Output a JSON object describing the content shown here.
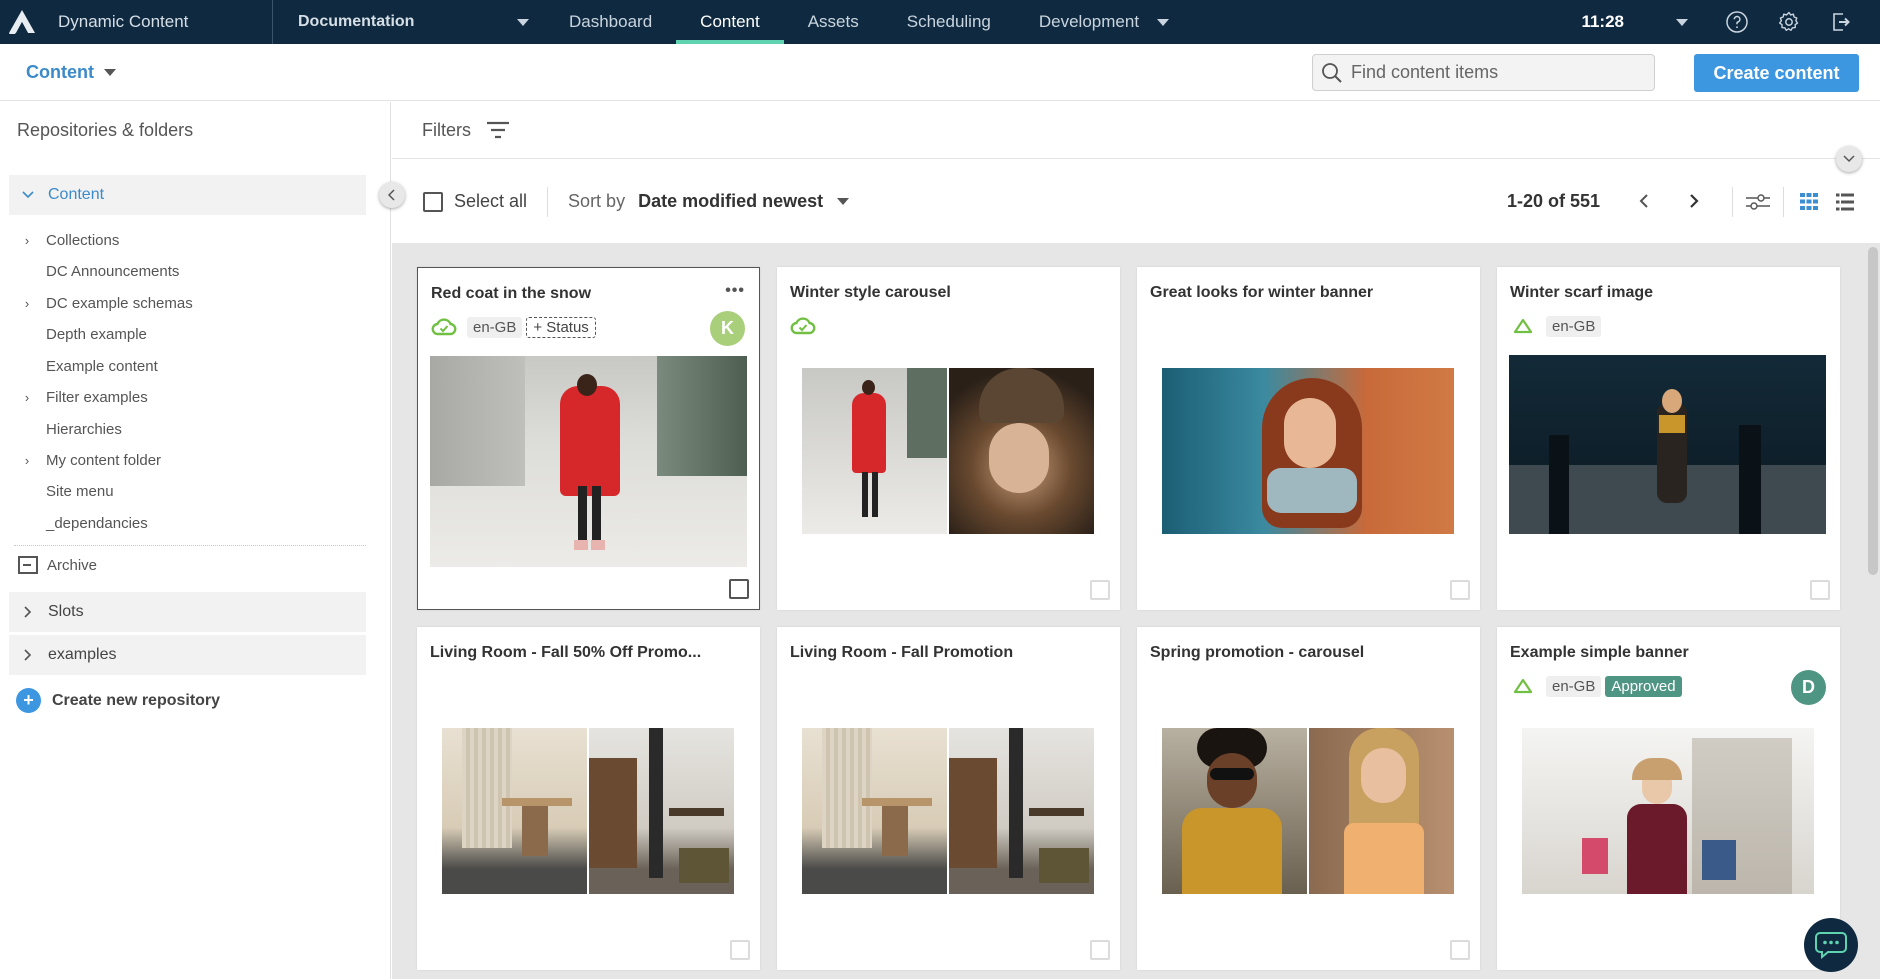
{
  "topnav": {
    "app_title": "Dynamic Content",
    "hub": "Documentation",
    "tabs": [
      {
        "label": "Dashboard",
        "active": false
      },
      {
        "label": "Content",
        "active": true
      },
      {
        "label": "Assets",
        "active": false
      },
      {
        "label": "Scheduling",
        "active": false
      },
      {
        "label": "Development",
        "active": false
      }
    ],
    "clock": "11:28",
    "icons": [
      "help-icon",
      "settings-icon",
      "logout-icon"
    ]
  },
  "subheader": {
    "context": "Content",
    "search_placeholder": "Find content items",
    "create_label": "Create content"
  },
  "sidebar": {
    "title": "Repositories & folders",
    "repos": [
      {
        "label": "Content",
        "open": true
      },
      {
        "label": "Slots",
        "open": false
      },
      {
        "label": "examples",
        "open": false
      }
    ],
    "folders": [
      {
        "label": "Collections",
        "expandable": true
      },
      {
        "label": "DC Announcements",
        "expandable": false
      },
      {
        "label": "DC example schemas",
        "expandable": true
      },
      {
        "label": "Depth example",
        "expandable": false
      },
      {
        "label": "Example content",
        "expandable": false
      },
      {
        "label": "Filter examples",
        "expandable": true
      },
      {
        "label": "Hierarchies",
        "expandable": false
      },
      {
        "label": "My content folder",
        "expandable": true
      },
      {
        "label": "Site menu",
        "expandable": false
      },
      {
        "label": "_dependancies",
        "expandable": false
      }
    ],
    "archive_label": "Archive",
    "create_repo_label": "Create new repository"
  },
  "filters": {
    "label": "Filters"
  },
  "toolbar": {
    "select_all": "Select all",
    "sort_by": "Sort by",
    "sort_value": "Date modified newest",
    "pagination": "1-20 of 551"
  },
  "colors": {
    "nav_bg": "#0f2a40",
    "accent": "#3d97e0",
    "active_tab": "#5fd3b0",
    "cloud_green": "#72c043",
    "approved": "#4f9583",
    "avatar_k": "#a9cf7a",
    "avatar_d": "#4f9583"
  },
  "cards": [
    {
      "title": "Red coat in the snow",
      "cloud": "published",
      "locale": "en-GB",
      "status_add": "+ Status",
      "avatar": "K",
      "selected": true,
      "more": "•••",
      "images": [
        "snow-street"
      ]
    },
    {
      "title": "Winter style carousel",
      "cloud": "published",
      "images": [
        "snow-street",
        "winter-hat"
      ]
    },
    {
      "title": "Great looks for winter banner",
      "images": [
        "scarf-portrait"
      ]
    },
    {
      "title": "Winter scarf image",
      "cloud": "outline",
      "locale": "en-GB",
      "images": [
        "dark-forest"
      ]
    },
    {
      "title": "Living Room - Fall 50% Off Promo...",
      "images": [
        "living-room",
        "study"
      ]
    },
    {
      "title": "Living Room - Fall Promotion",
      "images": [
        "living-room",
        "study"
      ]
    },
    {
      "title": "Spring promotion - carousel",
      "images": [
        "sunglasses",
        "orange-top"
      ]
    },
    {
      "title": "Example simple banner",
      "cloud": "outline",
      "locale": "en-GB",
      "status": "Approved",
      "avatar": "D",
      "images": [
        "shopping"
      ]
    }
  ]
}
